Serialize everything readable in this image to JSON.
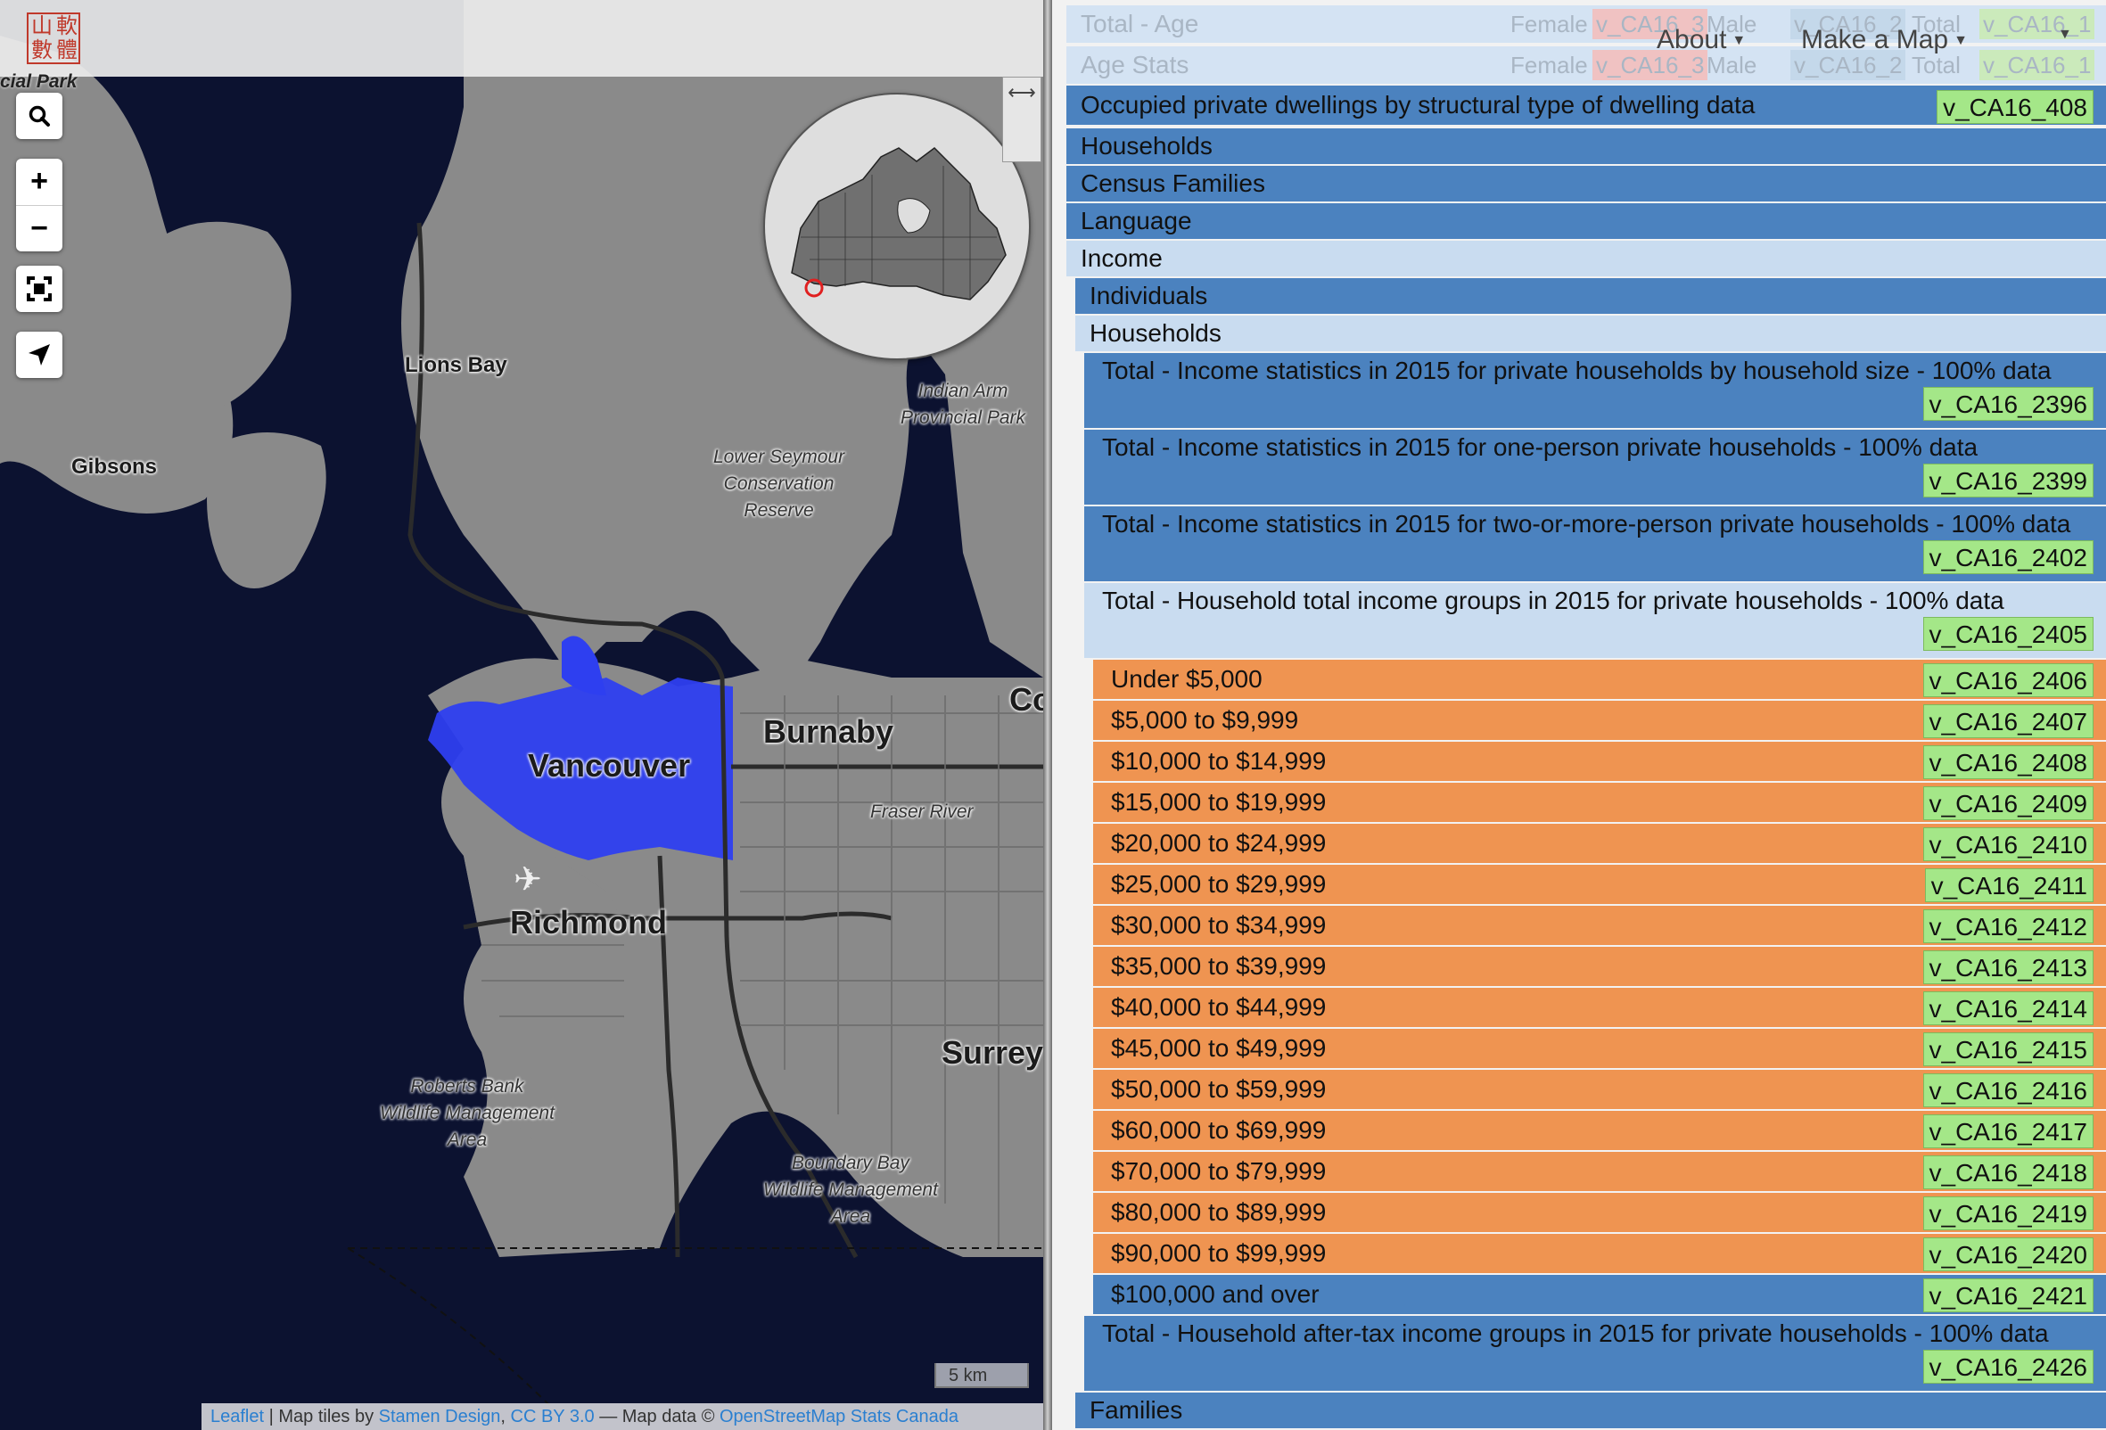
{
  "logo": {
    "chars": [
      "山",
      "軟",
      "數",
      "體"
    ]
  },
  "map": {
    "top_left_label": "cial Park",
    "labels": {
      "lions_bay": "Lions Bay",
      "gibsons": "Gibsons",
      "indian_arm": "Indian Arm\nProvincial Park",
      "lower_seymour": "Lower Seymour\nConservation\nReserve",
      "vancouver": "Vancouver",
      "burnaby": "Burnaby",
      "fraser_river": "Fraser River",
      "richmond": "Richmond",
      "surrey": "Surrey",
      "coquitlam_partial": "Co",
      "roberts_bank": "Roberts Bank\nWildlife Management\nArea",
      "boundary_bay": "Boundary Bay\nWildlife Management\nArea"
    },
    "scale": "5 km",
    "attribution": {
      "leaflet": "Leaflet",
      "sep1": " | Map tiles by ",
      "stamen": "Stamen Design",
      "sep2": ", ",
      "cc": "CC BY 3.0",
      "sep3": " — Map data © ",
      "osm": "OpenStreetMap",
      "sep4": " ",
      "statcan": "Stats Canada"
    },
    "colors": {
      "water": "#0c1230",
      "land": "#8a8a8a",
      "highlight": "#2e3ff0"
    }
  },
  "nav": {
    "about": "About",
    "make_map": "Make a Map"
  },
  "panel": {
    "faded_rows": [
      {
        "label": "Total - Age",
        "female": "Female",
        "female_code": "v_CA16_3",
        "male": "Male",
        "male_code": "v_CA16_2",
        "total": "Total",
        "total_code": "v_CA16_1"
      },
      {
        "label": "Age Stats",
        "female": "Female",
        "female_code": "v_CA16_3",
        "male": "Male",
        "male_code": "v_CA16_2",
        "total": "Total",
        "total_code": "v_CA16_1"
      }
    ],
    "occupied": {
      "label": "Occupied private dwellings by structural type of dwelling data",
      "code": "v_CA16_408"
    },
    "sections": [
      "Households",
      "Census Families",
      "Language",
      "Income"
    ],
    "income_sub": [
      "Individuals",
      "Households"
    ],
    "tall_rows": [
      {
        "label": "Total - Income statistics in 2015 for private households by household size - 100% data",
        "code": "v_CA16_2396"
      },
      {
        "label": "Total - Income statistics in 2015 for one-person private households - 100% data",
        "code": "v_CA16_2399"
      },
      {
        "label": "Total - Income statistics in 2015 for two-or-more-person private households - 100% data",
        "code": "v_CA16_2402"
      },
      {
        "label": "Total - Household total income groups in 2015 for private households - 100% data",
        "code": "v_CA16_2405"
      }
    ],
    "income_groups": [
      {
        "label": "Under $5,000",
        "code": "v_CA16_2406"
      },
      {
        "label": "$5,000 to $9,999",
        "code": "v_CA16_2407"
      },
      {
        "label": "$10,000 to $14,999",
        "code": "v_CA16_2408"
      },
      {
        "label": "$15,000 to $19,999",
        "code": "v_CA16_2409"
      },
      {
        "label": "$20,000 to $24,999",
        "code": "v_CA16_2410"
      },
      {
        "label": "$25,000 to $29,999",
        "code": "v_CA16_2411"
      },
      {
        "label": "$30,000 to $34,999",
        "code": "v_CA16_2412"
      },
      {
        "label": "$35,000 to $39,999",
        "code": "v_CA16_2413"
      },
      {
        "label": "$40,000 to $44,999",
        "code": "v_CA16_2414"
      },
      {
        "label": "$45,000 to $49,999",
        "code": "v_CA16_2415"
      },
      {
        "label": "$50,000 to $59,999",
        "code": "v_CA16_2416"
      },
      {
        "label": "$60,000 to $69,999",
        "code": "v_CA16_2417"
      },
      {
        "label": "$70,000 to $79,999",
        "code": "v_CA16_2418"
      },
      {
        "label": "$80,000 to $89,999",
        "code": "v_CA16_2419"
      },
      {
        "label": "$90,000 to $99,999",
        "code": "v_CA16_2420"
      },
      {
        "label": "$100,000 and over",
        "code": "v_CA16_2421"
      }
    ],
    "after_tax": {
      "label": "Total - Household after-tax income groups in 2015 for private households - 100% data",
      "code": "v_CA16_2426"
    },
    "families": "Families",
    "colors": {
      "blue": "#4b82bf",
      "light": "#c9dcf0",
      "orange": "#ef9451",
      "code": "#a4e788"
    }
  }
}
